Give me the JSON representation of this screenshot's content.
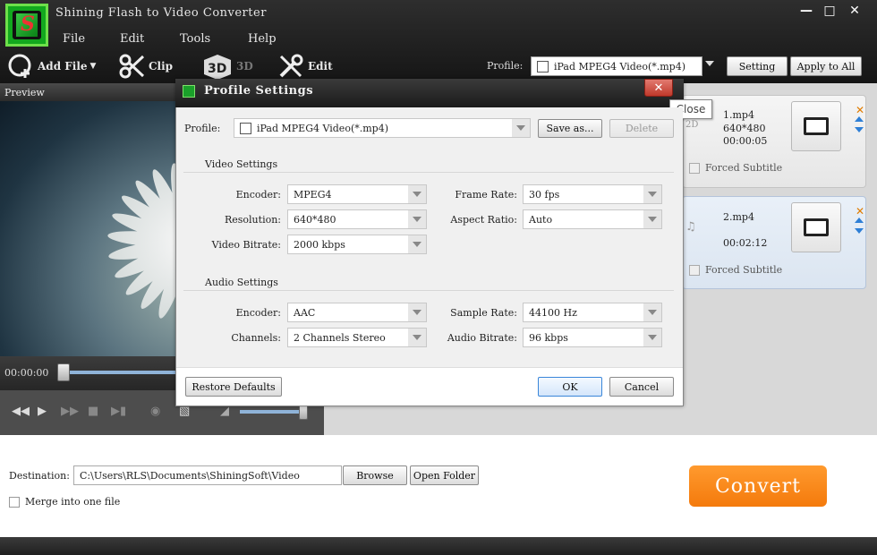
{
  "app": {
    "title": "Shining Flash to Video Converter"
  },
  "window_controls": {
    "minimize": "—",
    "maximize": "□",
    "close": "✕"
  },
  "menu": {
    "file": "File",
    "edit": "Edit",
    "tools": "Tools",
    "help": "Help"
  },
  "toolbar": {
    "add_file": "Add File",
    "clip": "Clip",
    "three_d": "3D",
    "edit": "Edit",
    "profile_label": "Profile:",
    "profile_value": "iPad MPEG4 Video(*.mp4)",
    "setting": "Setting",
    "apply_to_all": "Apply to All"
  },
  "preview": {
    "header": "Preview",
    "time": "00:00:00"
  },
  "files": [
    {
      "name": "1.mp4",
      "resolution": "640*480",
      "duration": "00:00:05",
      "badge": "2D",
      "subtitle": "Forced Subtitle"
    },
    {
      "name": "2.mp4",
      "duration": "00:02:12",
      "badge": "♫",
      "subtitle": "Forced Subtitle"
    }
  ],
  "bottom": {
    "destination_label": "Destination:",
    "destination_path": "C:\\Users\\RLS\\Documents\\ShiningSoft\\Video",
    "browse": "Browse",
    "open_folder": "Open Folder",
    "merge_label": "Merge into one file",
    "convert": "Convert"
  },
  "dialog": {
    "title": "Profile Settings",
    "close_tooltip": "Close",
    "close_glyph": "✕",
    "profile_label": "Profile:",
    "profile_value": "iPad MPEG4 Video(*.mp4)",
    "save_as": "Save as...",
    "delete": "Delete",
    "video_section": "Video Settings",
    "audio_section": "Audio Settings",
    "video": {
      "encoder_label": "Encoder:",
      "encoder": "MPEG4",
      "resolution_label": "Resolution:",
      "resolution": "640*480",
      "bitrate_label": "Video Bitrate:",
      "bitrate": "2000 kbps",
      "framerate_label": "Frame Rate:",
      "framerate": "30 fps",
      "aspect_label": "Aspect Ratio:",
      "aspect": "Auto"
    },
    "audio": {
      "encoder_label": "Encoder:",
      "encoder": "AAC",
      "channels_label": "Channels:",
      "channels": "2 Channels Stereo",
      "samplerate_label": "Sample Rate:",
      "samplerate": "44100 Hz",
      "bitrate_label": "Audio Bitrate:",
      "bitrate": "96 kbps"
    },
    "restore_defaults": "Restore Defaults",
    "ok": "OK",
    "cancel": "Cancel"
  }
}
